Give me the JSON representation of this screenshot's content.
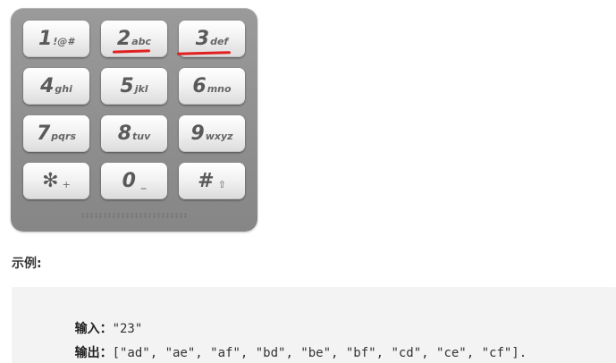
{
  "keypad": {
    "keys": [
      {
        "digit": "1",
        "letters": "!@#"
      },
      {
        "digit": "2",
        "letters": "abc"
      },
      {
        "digit": "3",
        "letters": "def"
      },
      {
        "digit": "4",
        "letters": "ghi"
      },
      {
        "digit": "5",
        "letters": "jkl"
      },
      {
        "digit": "6",
        "letters": "mno"
      },
      {
        "digit": "7",
        "letters": "pqrs"
      },
      {
        "digit": "8",
        "letters": "tuv"
      },
      {
        "digit": "9",
        "letters": "wxyz"
      },
      {
        "digit": "✻",
        "letters": "+"
      },
      {
        "digit": "0",
        "letters": "_"
      },
      {
        "digit": "#",
        "letters": "⇧"
      }
    ],
    "highlight_color": "#e02020"
  },
  "section_title": "示例:",
  "example": {
    "input_label": "输入：",
    "input_value": "\"23\"",
    "output_label": "输出：",
    "output_value": "[\"ad\", \"ae\", \"af\", \"bd\", \"be\", \"bf\", \"cd\", \"ce\", \"cf\"]."
  }
}
